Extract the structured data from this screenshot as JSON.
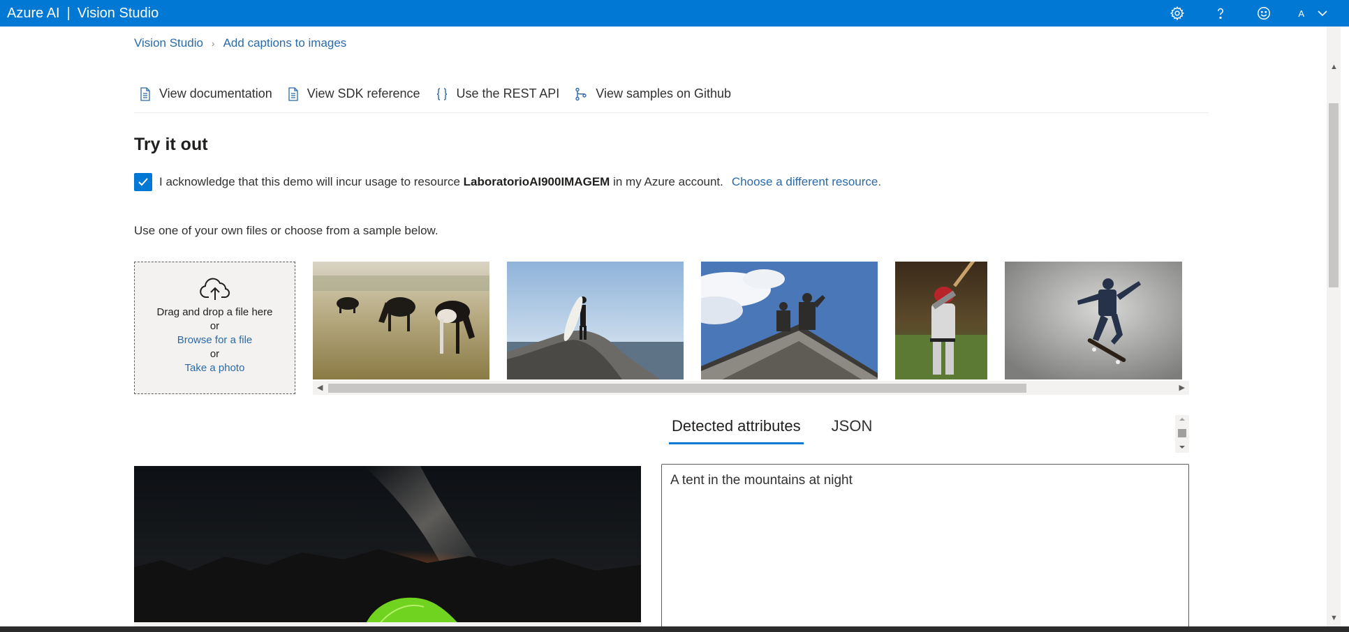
{
  "header": {
    "brand_left": "Azure AI",
    "brand_sep": "|",
    "brand_right": "Vision Studio",
    "account_initial": "A"
  },
  "breadcrumb": {
    "root": "Vision Studio",
    "current": "Add captions to images"
  },
  "links": {
    "documentation": "View documentation",
    "sdk": "View SDK reference",
    "rest": "Use the REST API",
    "github": "View samples on Github"
  },
  "try_it_out": {
    "title": "Try it out",
    "ack_prefix": "I acknowledge that this demo will incur usage to resource",
    "resource_name": "LaboratorioAI900IMAGEM",
    "ack_suffix": "in my Azure account.",
    "choose_resource": "Choose a different resource.",
    "use_files_text": "Use one of your own files or choose from a sample below."
  },
  "upload": {
    "drag_text": "Drag and drop a file here",
    "or1": "or",
    "browse": "Browse for a file",
    "or2": "or",
    "take_photo": "Take a photo"
  },
  "samples": [
    {
      "name": "cows-in-field"
    },
    {
      "name": "surfer-on-rock"
    },
    {
      "name": "building-statues"
    },
    {
      "name": "baseball-batter"
    },
    {
      "name": "skateboarder"
    }
  ],
  "results": {
    "tabs": [
      "Detected attributes",
      "JSON"
    ],
    "active_tab": "Detected attributes",
    "caption": "A tent in the mountains at night"
  },
  "colors": {
    "accent": "#0078d4",
    "link": "#2b6aa8"
  }
}
